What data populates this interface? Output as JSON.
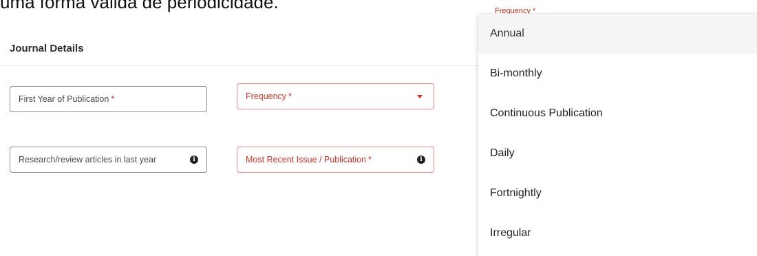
{
  "page": {
    "top_text": "uma forma válida de periodicidade."
  },
  "section": {
    "title": "Journal Details"
  },
  "fields": {
    "first_year": {
      "label": "First Year of Publication",
      "required_mark": "*"
    },
    "frequency": {
      "label": "Frequency",
      "required_mark": "*"
    },
    "research_articles": {
      "label": "Research/review articles in last year"
    },
    "recent_issue": {
      "label": "Most Recent Issue / Publication",
      "required_mark": "*"
    }
  },
  "icons": {
    "info": "info-icon",
    "caret": "caret-down-icon"
  },
  "dropdown": {
    "floating_label": "Frequency *",
    "options": [
      "Annual",
      "Bi-monthly",
      "Continuous Publication",
      "Daily",
      "Fortnightly",
      "Irregular"
    ],
    "highlighted_index": 0
  },
  "colors": {
    "error": "#d93025",
    "error_border": "#ef8a8a",
    "highlight": "#f5f5f5"
  }
}
